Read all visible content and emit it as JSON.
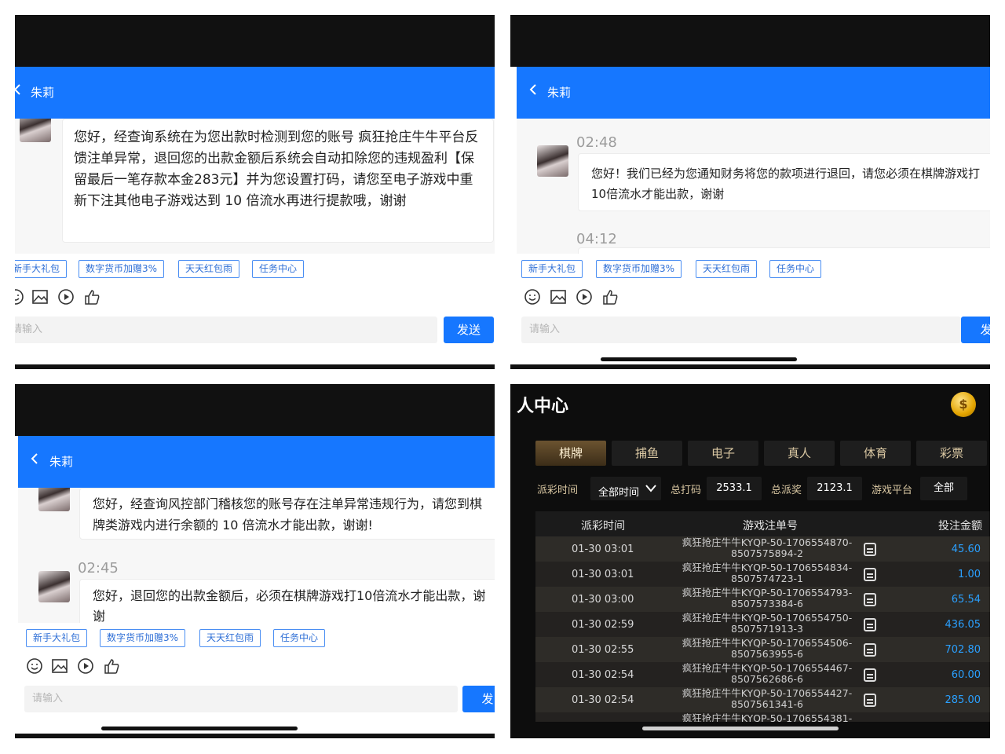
{
  "panel1": {
    "contact_name": "朱莉",
    "message": "您好，经查询系统在为您出款时检测到您的账号 疯狂抢庄牛牛平台反馈注单异常，退回您的出款金额后系统会自动扣除您的违规盈利【保留最后一笔存款本金283元】并为您设置打码，请您至电子游戏中重新下注其他电子游戏达到 10 倍流水再进行提款哦，谢谢",
    "quick_buttons": [
      "新手大礼包",
      "数字货币加赠3%",
      "天天红包雨",
      "任务中心"
    ],
    "input_placeholder": "请输入",
    "send_label": "发送"
  },
  "panel2": {
    "contact_name": "朱莉",
    "time1": "02:48",
    "message": "您好！我们已经为您通知财务将您的款项进行退回，请您必须在棋牌游戏打10倍流水才能出款，谢谢",
    "time2": "04:12",
    "quick_buttons": [
      "新手大礼包",
      "数字货币加赠3%",
      "天天红包雨",
      "任务中心"
    ],
    "input_placeholder": "请输入",
    "send_label": "发"
  },
  "panel3": {
    "contact_name": "朱莉",
    "message1": "您好，经查询风控部门稽核您的账号存在注单异常违规行为，请您到棋牌类游戏内进行余额的 10 倍流水才能出款，谢谢!",
    "time": "02:45",
    "message2": "您好，退回您的出款金额后，必须在棋牌游戏打10倍流水才能出款，谢谢",
    "quick_buttons": [
      "新手大礼包",
      "数字货币加赠3%",
      "天天红包雨",
      "任务中心"
    ],
    "input_placeholder": "请输入",
    "send_label": "发"
  },
  "panel4": {
    "title": "人中心",
    "coin_symbol": "$",
    "tabs": [
      "棋牌",
      "捕鱼",
      "电子",
      "真人",
      "体育",
      "彩票"
    ],
    "filter": {
      "time_label": "派彩时间",
      "time_value": "全部时间",
      "bet_label": "总打码",
      "bet_value": "2533.1",
      "payout_label": "总派奖",
      "payout_value": "2123.1",
      "platform_label": "游戏平台",
      "platform_value": "全部"
    },
    "columns": [
      "派彩时间",
      "游戏注单号",
      "投注金额"
    ],
    "rows": [
      {
        "time": "01-30 03:01",
        "order": "疯狂抢庄牛牛KYQP-50-1706554870-8507575894-2",
        "amount": "45.60"
      },
      {
        "time": "01-30 03:01",
        "order": "疯狂抢庄牛牛KYQP-50-1706554834-8507574723-1",
        "amount": "1.00"
      },
      {
        "time": "01-30 03:00",
        "order": "疯狂抢庄牛牛KYQP-50-1706554793-8507573384-6",
        "amount": "65.54"
      },
      {
        "time": "01-30 02:59",
        "order": "疯狂抢庄牛牛KYQP-50-1706554750-8507571913-3",
        "amount": "436.05"
      },
      {
        "time": "01-30 02:55",
        "order": "疯狂抢庄牛牛KYQP-50-1706554506-8507563955-6",
        "amount": "702.80"
      },
      {
        "time": "01-30 02:54",
        "order": "疯狂抢庄牛牛KYQP-50-1706554467-8507562686-6",
        "amount": "60.00"
      },
      {
        "time": "01-30 02:54",
        "order": "疯狂抢庄牛牛KYQP-50-1706554427-8507561341-6",
        "amount": "285.00"
      },
      {
        "time": "",
        "order": "疯狂抢庄牛牛KYQP-50-1706554381-",
        "amount": ""
      }
    ]
  }
}
